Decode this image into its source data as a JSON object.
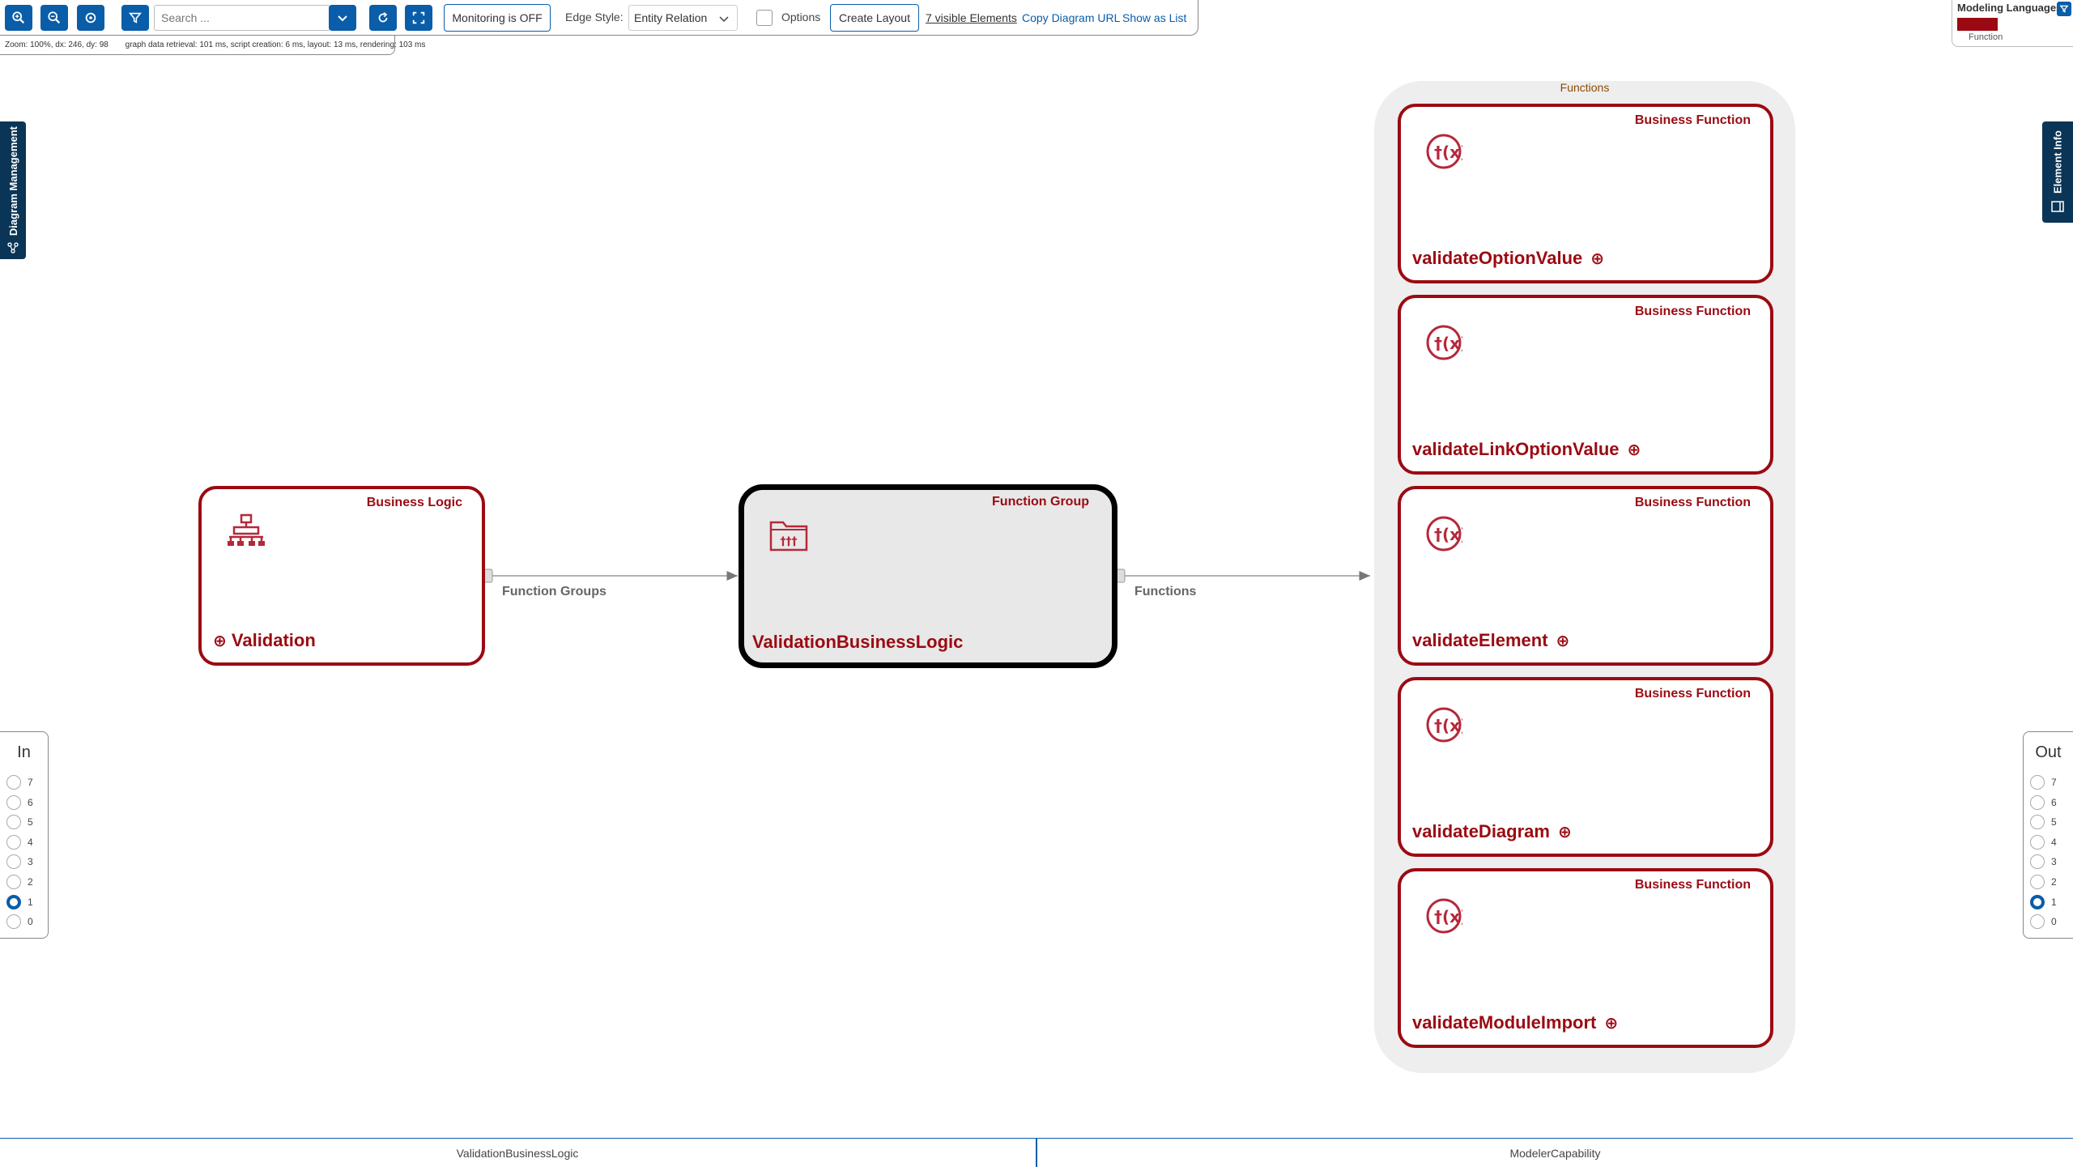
{
  "toolbar": {
    "search_placeholder": "Search ...",
    "monitoring_label": "Monitoring is OFF",
    "edge_style_label": "Edge Style:",
    "edge_style_value": "Entity Relation",
    "options_label": "Options",
    "create_layout_label": "Create Layout",
    "visible_elements_label": "7 visible Elements",
    "copy_url_label": "Copy Diagram URL",
    "show_list_label": "Show as List"
  },
  "status": {
    "zoom": "Zoom: 100%, dx: 246, dy: 98",
    "timing": "graph data retrieval: 101 ms, script creation: 6 ms, layout: 13 ms, rendering: 103 ms"
  },
  "side_tabs": {
    "left": "Diagram Management",
    "right": "Element Info"
  },
  "modeling_languages": {
    "title": "Modeling Languages",
    "legend_label": "Function",
    "legend_color": "#9b0a12"
  },
  "in_panel": {
    "title": "In",
    "options": [
      "7",
      "6",
      "5",
      "4",
      "3",
      "2",
      "1",
      "0"
    ],
    "selected": "1"
  },
  "out_panel": {
    "title": "Out",
    "options": [
      "7",
      "6",
      "5",
      "4",
      "3",
      "2",
      "1",
      "0"
    ],
    "selected": "1"
  },
  "diagram": {
    "validation_node": {
      "type": "Business Logic",
      "label": "Validation"
    },
    "group_node": {
      "type": "Function Group",
      "label": "ValidationBusinessLogic"
    },
    "edge_function_groups": "Function Groups",
    "edge_functions": "Functions",
    "functions_group_title": "Functions",
    "functions": [
      {
        "type": "Business Function",
        "label": "validateOptionValue"
      },
      {
        "type": "Business Function",
        "label": "validateLinkOptionValue"
      },
      {
        "type": "Business Function",
        "label": "validateElement"
      },
      {
        "type": "Business Function",
        "label": "validateDiagram"
      },
      {
        "type": "Business Function",
        "label": "validateModuleImport"
      }
    ]
  },
  "bottom_tabs": [
    "ValidationBusinessLogic",
    "ModelerCapability"
  ],
  "colors": {
    "accent": "#0a5da8",
    "node_red": "#9b0a12",
    "dark_tab": "#0b3556"
  }
}
